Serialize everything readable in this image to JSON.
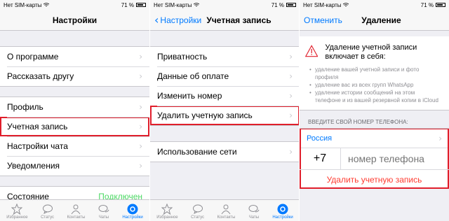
{
  "status": {
    "carrier": "Нет SIM-карты",
    "battery": "71 %"
  },
  "screen1": {
    "title": "Настройки",
    "group1": [
      "О программе",
      "Рассказать другу"
    ],
    "group2": [
      "Профиль",
      "Учетная запись",
      "Настройки чата",
      "Уведомления"
    ],
    "group3": {
      "label": "Состояние",
      "value": "Подключен"
    }
  },
  "screen2": {
    "back": "Настройки",
    "title": "Учетная запись",
    "group1": [
      "Приватность",
      "Данные об оплате",
      "Изменить номер",
      "Удалить учетную запись"
    ],
    "group2": [
      "Использование сети"
    ]
  },
  "screen3": {
    "cancel": "Отменить",
    "title": "Удаление",
    "warning_title": "Удаление учетной записи включает в себя:",
    "bullets": [
      "удаление вашей учетной записи и фото профиля",
      "удаление вас из всех групп WhatsApp",
      "удаление истории сообщений на этом телефоне и из вашей резервной копии в iCloud"
    ],
    "section_header": "ВВЕДИТЕ СВОЙ НОМЕР ТЕЛЕФОНА:",
    "country": "Россия",
    "code": "+7",
    "phone_placeholder": "номер телефона",
    "delete_button": "Удалить учетную запись"
  },
  "tabbar": [
    "Избранное",
    "Статус",
    "Контакты",
    "Чаты",
    "Настройки"
  ],
  "colors": {
    "accent": "#007aff",
    "highlight": "#e01e2b",
    "success": "#4cd964",
    "danger": "#ff3b30"
  }
}
